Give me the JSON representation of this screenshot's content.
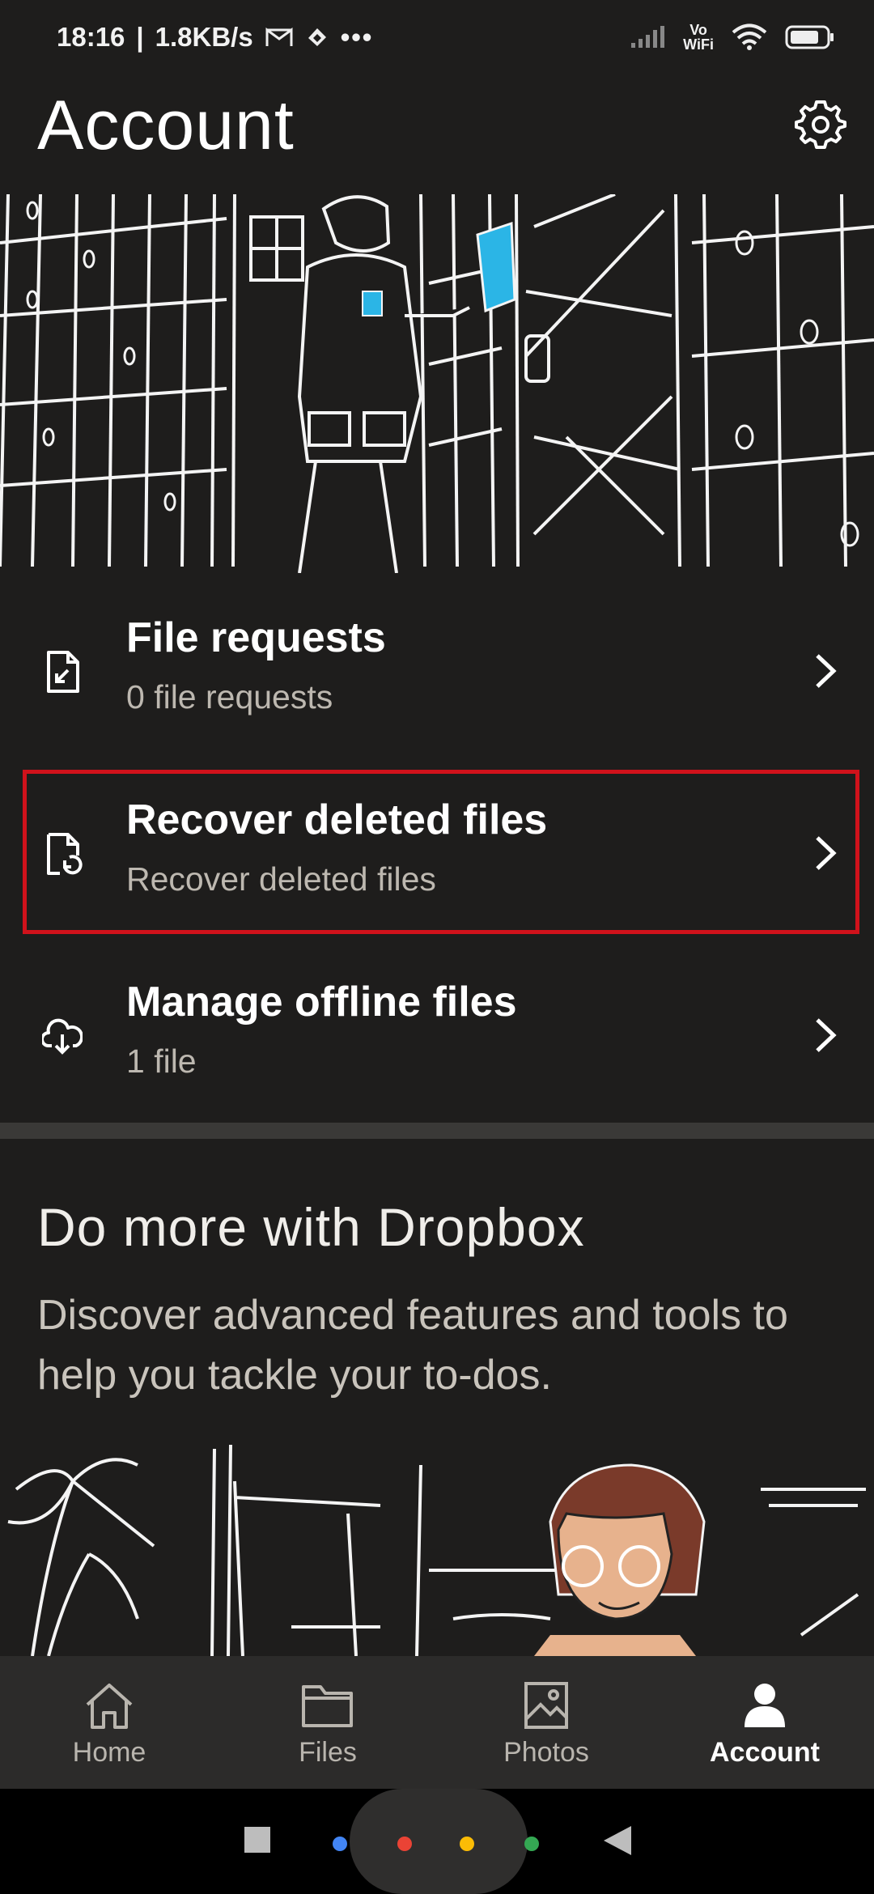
{
  "status_bar": {
    "time": "18:16",
    "speed": "1.8KB/s",
    "vowifi_top": "Vo",
    "vowifi_bottom": "WiFi"
  },
  "header": {
    "title": "Account",
    "settings_icon": "gear-icon"
  },
  "list": [
    {
      "title": "File requests",
      "subtitle": "0 file requests",
      "icon": "file-request-icon"
    },
    {
      "title": "Recover deleted files",
      "subtitle": "Recover deleted files",
      "icon": "file-restore-icon"
    },
    {
      "title": "Manage offline files",
      "subtitle": "1 file",
      "icon": "cloud-download-icon"
    }
  ],
  "promo": {
    "title": "Do more with Dropbox",
    "description": "Discover advanced features and tools to help you tackle your to-dos."
  },
  "bottom_nav": [
    {
      "label": "Home",
      "icon": "home-icon",
      "active": false
    },
    {
      "label": "Files",
      "icon": "folder-icon",
      "active": false
    },
    {
      "label": "Photos",
      "icon": "photo-icon",
      "active": false
    },
    {
      "label": "Account",
      "icon": "person-icon",
      "active": true
    }
  ],
  "colors": {
    "background": "#1e1d1c",
    "highlight": "#d0121b",
    "accent_blue": "#2bb5e6"
  }
}
